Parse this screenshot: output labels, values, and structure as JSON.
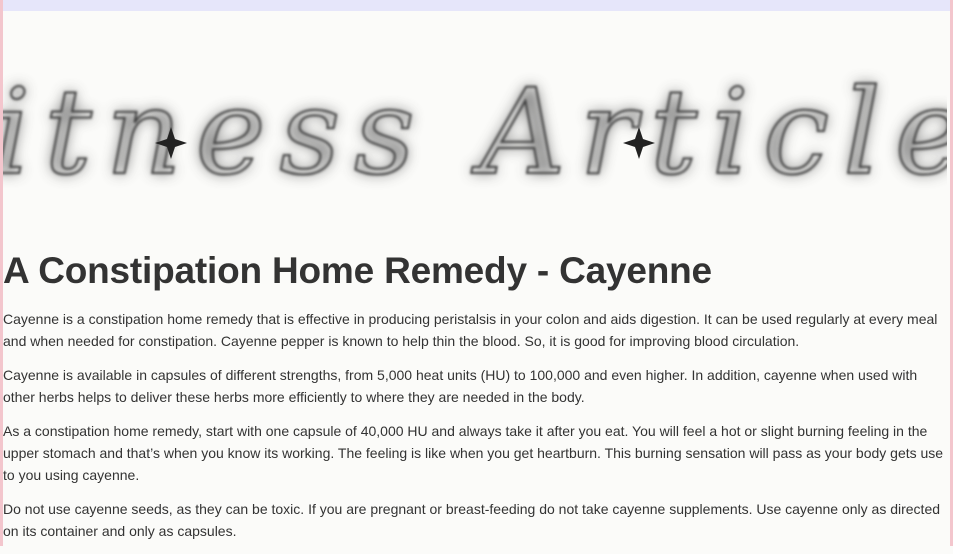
{
  "banner": {
    "logo_text": "Fitness Articles"
  },
  "article": {
    "title": "A Constipation Home Remedy - Cayenne",
    "paragraphs": [
      "Cayenne is a constipation home remedy that is effective in producing peristalsis in your colon and aids digestion. It can be used regularly at every meal and when needed for constipation. Cayenne pepper is known to help thin the blood. So, it is good for improving blood circulation.",
      "Cayenne is available in capsules of different strengths, from 5,000 heat units (HU) to 100,000 and even higher. In addition, cayenne when used with other herbs helps to deliver these herbs more efficiently to where they are needed in the body.",
      "As a constipation home remedy, start with one capsule of 40,000 HU and always take it after you eat. You will feel a hot or slight burning feeling in the upper stomach and that’s when you know its working. The feeling is like when you get heartburn. This burning sensation will pass as your body gets use to you using cayenne.",
      "Do not use cayenne seeds, as they can be toxic. If you are pregnant or breast-feeding do not take cayenne supplements. Use cayenne only as directed on its container and only as capsules."
    ]
  },
  "colors": {
    "frame": "#f3c6cd",
    "top_band": "#e6e6fa",
    "page_bg": "#fbfbf9",
    "text": "#333333"
  }
}
